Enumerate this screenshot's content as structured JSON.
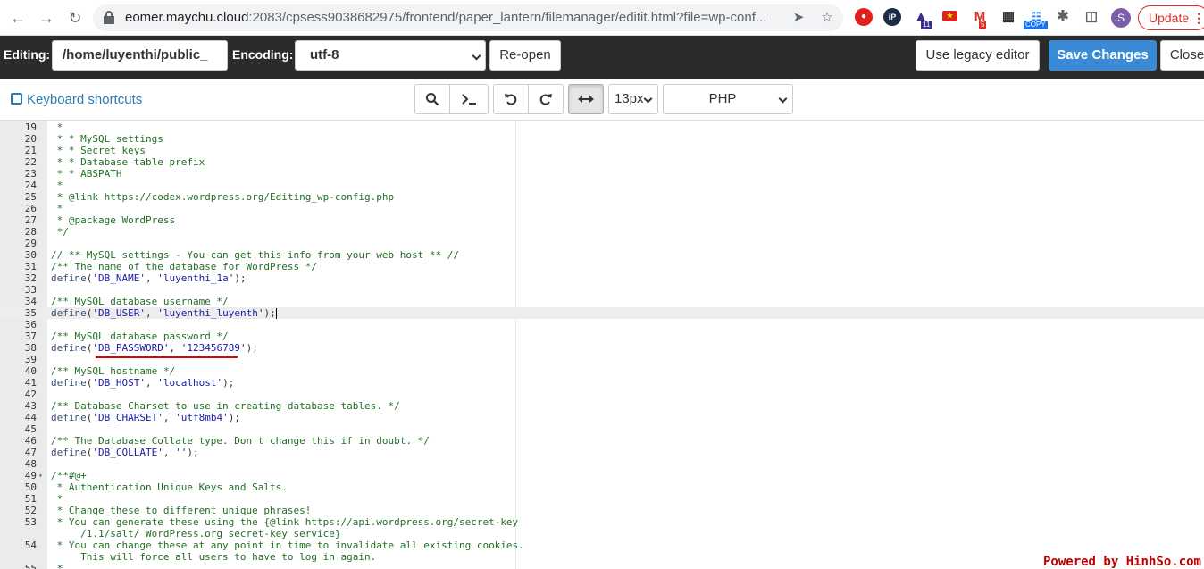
{
  "browser": {
    "url_host": "eomer.maychu.cloud",
    "url_rest": ":2083/cpsess9038682975/frontend/paper_lantern/filemanager/editit.html?file=wp-conf...",
    "profile_initial": "S",
    "update_label": "Update",
    "badge_a": "11",
    "badge_b": "5",
    "badge_c": "COPY"
  },
  "header": {
    "editing_label": "Editing:",
    "path_value": "/home/luyenthi/public_",
    "encoding_label": "Encoding:",
    "encoding_value": "utf-8",
    "reopen_label": "Re-open",
    "legacy_label": "Use legacy editor",
    "save_label": "Save Changes",
    "close_label": "Close"
  },
  "toolbar": {
    "shortcuts_label": "Keyboard shortcuts",
    "font_size": "13px",
    "mode": "PHP"
  },
  "editor": {
    "active_line": 35,
    "lines": [
      {
        "n": "19",
        "t": " *",
        "k": "com"
      },
      {
        "n": "20",
        "t": " * * MySQL settings",
        "k": "com"
      },
      {
        "n": "21",
        "t": " * * Secret keys",
        "k": "com"
      },
      {
        "n": "22",
        "t": " * * Database table prefix",
        "k": "com"
      },
      {
        "n": "23",
        "t": " * * ABSPATH",
        "k": "com"
      },
      {
        "n": "24",
        "t": " *",
        "k": "com"
      },
      {
        "n": "25",
        "t": " * @link https://codex.wordpress.org/Editing_wp-config.php",
        "k": "com"
      },
      {
        "n": "26",
        "t": " *",
        "k": "com"
      },
      {
        "n": "27",
        "t": " * @package WordPress",
        "k": "com"
      },
      {
        "n": "28",
        "t": " */",
        "k": "com"
      },
      {
        "n": "29",
        "t": "",
        "k": "com"
      },
      {
        "n": "30",
        "t": "// ** MySQL settings - You can get this info from your web host ** //",
        "k": "com"
      },
      {
        "n": "31",
        "t": "/** The name of the database for WordPress */",
        "k": "com"
      },
      {
        "n": "32",
        "fn": "define",
        "a": "'DB_NAME'",
        "b": "'luyenthi_1a'",
        "k": "def"
      },
      {
        "n": "33",
        "t": "",
        "k": "com"
      },
      {
        "n": "34",
        "t": "/** MySQL database username */",
        "k": "com"
      },
      {
        "n": "35",
        "fn": "define",
        "a": "'DB_USER'",
        "b": "'luyenthi_luyenth'",
        "k": "def"
      },
      {
        "n": "36",
        "t": "",
        "k": "com"
      },
      {
        "n": "37",
        "t": "/** MySQL database password */",
        "k": "com"
      },
      {
        "n": "38",
        "fn": "define",
        "a": "'DB_PASSWORD'",
        "b": "'123456789'",
        "k": "def"
      },
      {
        "n": "39",
        "t": "",
        "k": "com"
      },
      {
        "n": "40",
        "t": "/** MySQL hostname */",
        "k": "com"
      },
      {
        "n": "41",
        "fn": "define",
        "a": "'DB_HOST'",
        "b": "'localhost'",
        "k": "def"
      },
      {
        "n": "42",
        "t": "",
        "k": "com"
      },
      {
        "n": "43",
        "t": "/** Database Charset to use in creating database tables. */",
        "k": "com"
      },
      {
        "n": "44",
        "fn": "define",
        "a": "'DB_CHARSET'",
        "b": "'utf8mb4'",
        "k": "def"
      },
      {
        "n": "45",
        "t": "",
        "k": "com"
      },
      {
        "n": "46",
        "t": "/** The Database Collate type. Don't change this if in doubt. */",
        "k": "com"
      },
      {
        "n": "47",
        "fn": "define",
        "a": "'DB_COLLATE'",
        "b": "''",
        "k": "def"
      },
      {
        "n": "48",
        "t": "",
        "k": "com"
      },
      {
        "n": "49",
        "t": "/**#@+",
        "k": "com",
        "fold": true
      },
      {
        "n": "50",
        "t": " * Authentication Unique Keys and Salts.",
        "k": "com"
      },
      {
        "n": "51",
        "t": " *",
        "k": "com"
      },
      {
        "n": "52",
        "t": " * Change these to different unique phrases!",
        "k": "com"
      },
      {
        "n": "53",
        "t": " * You can generate these using the {@link https://api.wordpress.org/secret-key",
        "k": "com"
      },
      {
        "n": "",
        "t": "     /1.1/salt/ WordPress.org secret-key service}",
        "k": "com"
      },
      {
        "n": "54",
        "t": " * You can change these at any point in time to invalidate all existing cookies.",
        "k": "com"
      },
      {
        "n": "",
        "t": "     This will force all users to have to log in again.",
        "k": "com"
      },
      {
        "n": "55",
        "t": " *",
        "k": "com"
      }
    ]
  },
  "watermark": "Powered by HinhSo.com"
}
